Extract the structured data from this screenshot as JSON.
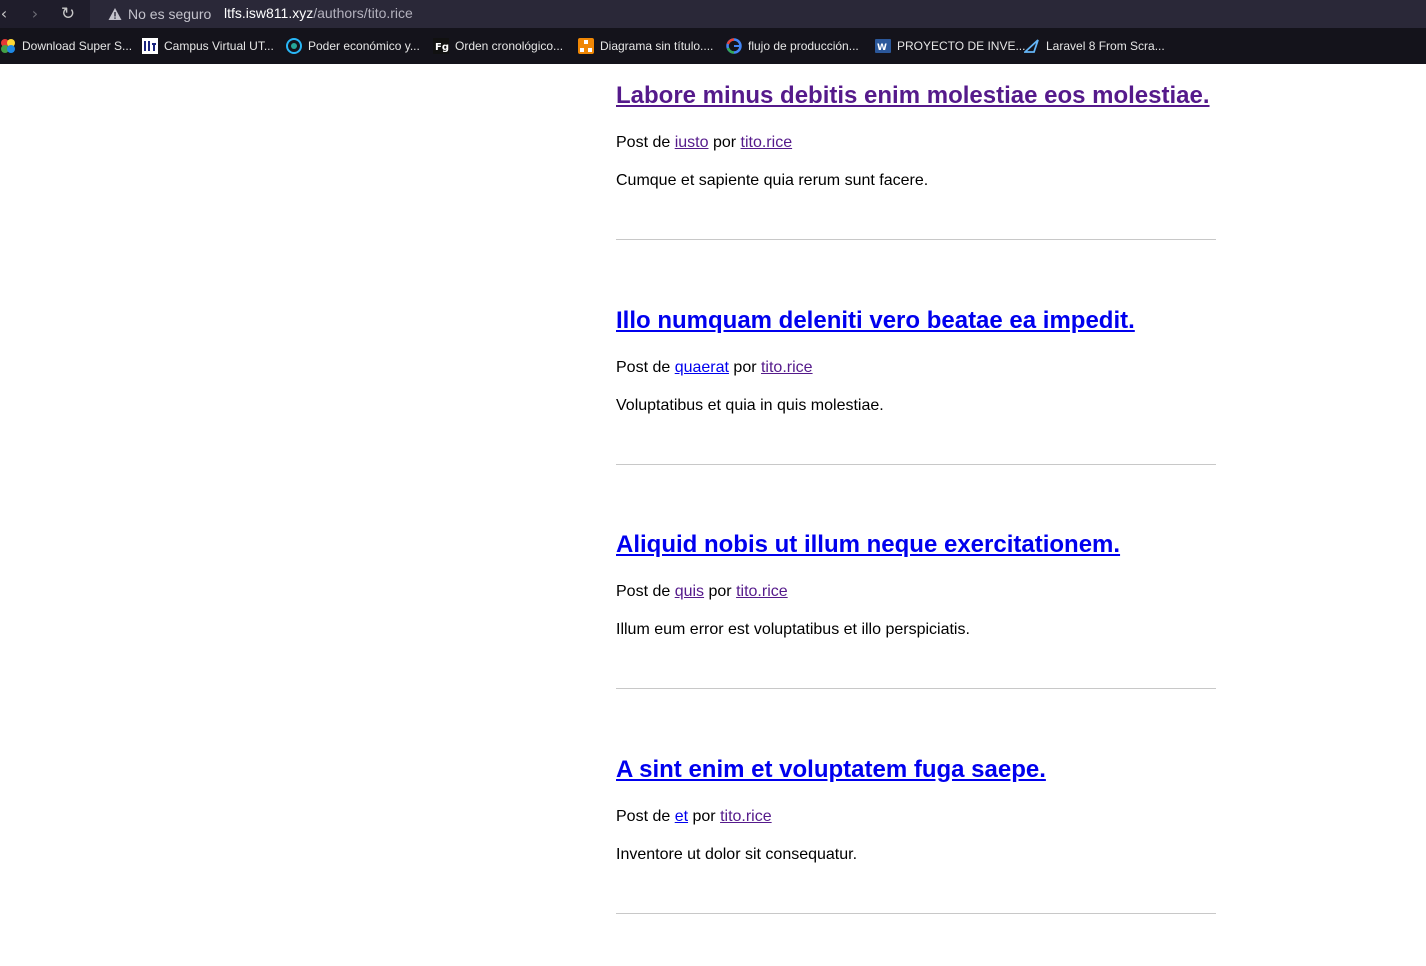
{
  "browser": {
    "security_label": "No es seguro",
    "url_domain": "ltfs.isw811.xyz",
    "url_path": "/authors/tito.rice"
  },
  "bookmarks": [
    {
      "label": "Download Super S...",
      "icon": "colorful-app-icon"
    },
    {
      "label": "Campus Virtual UT...",
      "icon": "utn-logo-icon"
    },
    {
      "label": "Poder económico y...",
      "icon": "globe-icon"
    },
    {
      "label": "Orden cronológico...",
      "icon": "fg-icon"
    },
    {
      "label": "Diagrama sin título....",
      "icon": "diagram-icon"
    },
    {
      "label": "flujo de producción...",
      "icon": "google-icon"
    },
    {
      "label": "PROYECTO DE INVE...",
      "icon": "word-icon"
    },
    {
      "label": "Laravel 8 From Scra...",
      "icon": "laracasts-icon"
    }
  ],
  "posts": [
    {
      "title": "Labore minus debitis enim molestiae eos molestiae.",
      "prefix": "Post de ",
      "category": "iusto",
      "by": " por ",
      "author": "tito.rice",
      "excerpt": "Cumque et sapiente quia rerum sunt facere."
    },
    {
      "title": "Illo numquam deleniti vero beatae ea impedit.",
      "prefix": "Post de ",
      "category": "quaerat",
      "by": " por ",
      "author": "tito.rice",
      "excerpt": "Voluptatibus et quia in quis molestiae."
    },
    {
      "title": "Aliquid nobis ut illum neque exercitationem.",
      "prefix": "Post de ",
      "category": "quis",
      "by": " por ",
      "author": "tito.rice",
      "excerpt": "Illum eum error est voluptatibus et illo perspiciatis."
    },
    {
      "title": "A sint enim et voluptatem fuga saepe.",
      "prefix": "Post de ",
      "category": "et",
      "by": " por ",
      "author": "tito.rice",
      "excerpt": "Inventore ut dolor sit consequatur."
    }
  ],
  "colors": {
    "link": "#0000ee",
    "visited": "#551a8b",
    "divider": "#c8c8c8"
  }
}
